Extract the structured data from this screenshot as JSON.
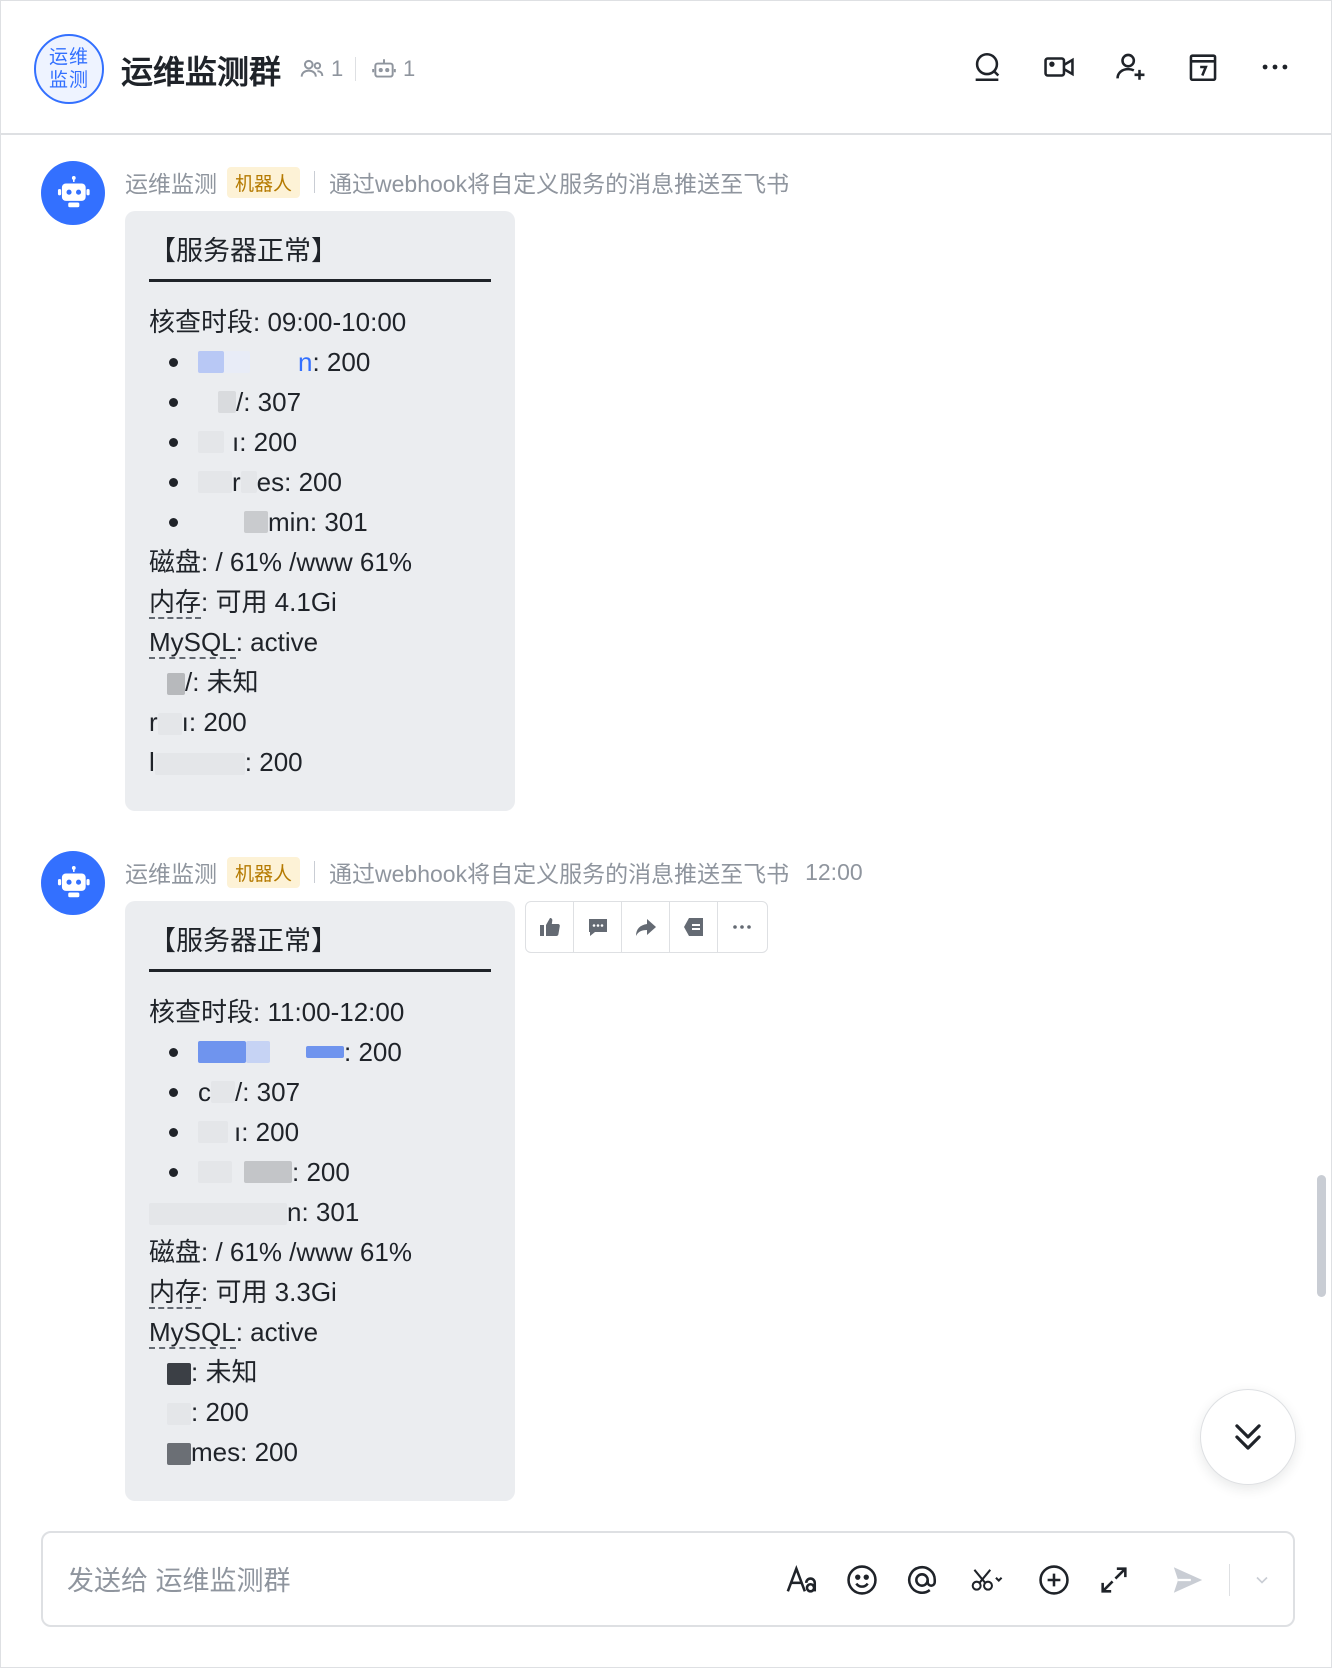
{
  "header": {
    "avatar_text": "运维监测",
    "title": "运维监测群",
    "member_count": "1",
    "bot_count": "1"
  },
  "messages": [
    {
      "sender": "运维监测",
      "tag": "机器人",
      "description": "通过webhook将自定义服务的消息推送至飞书",
      "time": "",
      "title": "【服务器正常】",
      "period": "核查时段: 09:00-10:00",
      "items": [
        {
          "pre": "",
          "visible": "n: 200",
          "link": "n"
        },
        {
          "pre": "",
          "visible": "/: 307"
        },
        {
          "pre": "",
          "visible": "ı: 200"
        },
        {
          "pre": "r",
          "visible": "es: 200"
        },
        {
          "pre": "",
          "visible": "min: 301"
        }
      ],
      "disk": "磁盘: / 61% /www 61%",
      "memory_label": "内存",
      "memory_value": ": 可用 4.1Gi",
      "mysql_label": "MySQL",
      "mysql_value": ": active",
      "extra_lines": [
        {
          "pre": "",
          "visible": "/: 未知"
        },
        {
          "pre": "r",
          "visible": "ı: 200"
        },
        {
          "pre": "l",
          "visible": ": 200"
        }
      ]
    },
    {
      "sender": "运维监测",
      "tag": "机器人",
      "description": "通过webhook将自定义服务的消息推送至飞书",
      "time": "12:00",
      "title": "【服务器正常】",
      "period": "核查时段: 11:00-12:00",
      "items": [
        {
          "pre": "",
          "visible": ": 200"
        },
        {
          "pre": "c",
          "visible": "/: 307"
        },
        {
          "pre": "",
          "visible": "ı: 200"
        },
        {
          "pre": "",
          "visible": ": 200"
        }
      ],
      "unbulleted": "n: 301",
      "disk": "磁盘: / 61% /www 61%",
      "memory_label": "内存",
      "memory_value": ": 可用 3.3Gi",
      "mysql_label": "MySQL",
      "mysql_value": ": active",
      "extra_lines": [
        {
          "pre": "",
          "visible": ": 未知"
        },
        {
          "pre": "",
          "visible": ": 200"
        },
        {
          "pre": "",
          "visible": "mes: 200"
        }
      ]
    }
  ],
  "composer": {
    "placeholder": "发送给 运维监测群"
  },
  "colors": {
    "accent": "#3370ff",
    "bubble": "#ebedf0",
    "tag_bg": "#fdf2d6",
    "tag_text": "#b57a00",
    "muted": "#8f959e"
  }
}
